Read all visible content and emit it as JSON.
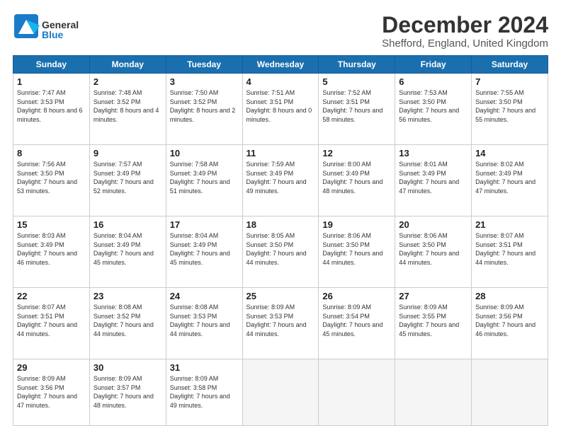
{
  "logo": {
    "general": "General",
    "blue": "Blue"
  },
  "title": "December 2024",
  "location": "Shefford, England, United Kingdom",
  "headers": [
    "Sunday",
    "Monday",
    "Tuesday",
    "Wednesday",
    "Thursday",
    "Friday",
    "Saturday"
  ],
  "weeks": [
    [
      {
        "day": "1",
        "sunrise": "Sunrise: 7:47 AM",
        "sunset": "Sunset: 3:53 PM",
        "daylight": "Daylight: 8 hours and 6 minutes."
      },
      {
        "day": "2",
        "sunrise": "Sunrise: 7:48 AM",
        "sunset": "Sunset: 3:52 PM",
        "daylight": "Daylight: 8 hours and 4 minutes."
      },
      {
        "day": "3",
        "sunrise": "Sunrise: 7:50 AM",
        "sunset": "Sunset: 3:52 PM",
        "daylight": "Daylight: 8 hours and 2 minutes."
      },
      {
        "day": "4",
        "sunrise": "Sunrise: 7:51 AM",
        "sunset": "Sunset: 3:51 PM",
        "daylight": "Daylight: 8 hours and 0 minutes."
      },
      {
        "day": "5",
        "sunrise": "Sunrise: 7:52 AM",
        "sunset": "Sunset: 3:51 PM",
        "daylight": "Daylight: 7 hours and 58 minutes."
      },
      {
        "day": "6",
        "sunrise": "Sunrise: 7:53 AM",
        "sunset": "Sunset: 3:50 PM",
        "daylight": "Daylight: 7 hours and 56 minutes."
      },
      {
        "day": "7",
        "sunrise": "Sunrise: 7:55 AM",
        "sunset": "Sunset: 3:50 PM",
        "daylight": "Daylight: 7 hours and 55 minutes."
      }
    ],
    [
      {
        "day": "8",
        "sunrise": "Sunrise: 7:56 AM",
        "sunset": "Sunset: 3:50 PM",
        "daylight": "Daylight: 7 hours and 53 minutes."
      },
      {
        "day": "9",
        "sunrise": "Sunrise: 7:57 AM",
        "sunset": "Sunset: 3:49 PM",
        "daylight": "Daylight: 7 hours and 52 minutes."
      },
      {
        "day": "10",
        "sunrise": "Sunrise: 7:58 AM",
        "sunset": "Sunset: 3:49 PM",
        "daylight": "Daylight: 7 hours and 51 minutes."
      },
      {
        "day": "11",
        "sunrise": "Sunrise: 7:59 AM",
        "sunset": "Sunset: 3:49 PM",
        "daylight": "Daylight: 7 hours and 49 minutes."
      },
      {
        "day": "12",
        "sunrise": "Sunrise: 8:00 AM",
        "sunset": "Sunset: 3:49 PM",
        "daylight": "Daylight: 7 hours and 48 minutes."
      },
      {
        "day": "13",
        "sunrise": "Sunrise: 8:01 AM",
        "sunset": "Sunset: 3:49 PM",
        "daylight": "Daylight: 7 hours and 47 minutes."
      },
      {
        "day": "14",
        "sunrise": "Sunrise: 8:02 AM",
        "sunset": "Sunset: 3:49 PM",
        "daylight": "Daylight: 7 hours and 47 minutes."
      }
    ],
    [
      {
        "day": "15",
        "sunrise": "Sunrise: 8:03 AM",
        "sunset": "Sunset: 3:49 PM",
        "daylight": "Daylight: 7 hours and 46 minutes."
      },
      {
        "day": "16",
        "sunrise": "Sunrise: 8:04 AM",
        "sunset": "Sunset: 3:49 PM",
        "daylight": "Daylight: 7 hours and 45 minutes."
      },
      {
        "day": "17",
        "sunrise": "Sunrise: 8:04 AM",
        "sunset": "Sunset: 3:49 PM",
        "daylight": "Daylight: 7 hours and 45 minutes."
      },
      {
        "day": "18",
        "sunrise": "Sunrise: 8:05 AM",
        "sunset": "Sunset: 3:50 PM",
        "daylight": "Daylight: 7 hours and 44 minutes."
      },
      {
        "day": "19",
        "sunrise": "Sunrise: 8:06 AM",
        "sunset": "Sunset: 3:50 PM",
        "daylight": "Daylight: 7 hours and 44 minutes."
      },
      {
        "day": "20",
        "sunrise": "Sunrise: 8:06 AM",
        "sunset": "Sunset: 3:50 PM",
        "daylight": "Daylight: 7 hours and 44 minutes."
      },
      {
        "day": "21",
        "sunrise": "Sunrise: 8:07 AM",
        "sunset": "Sunset: 3:51 PM",
        "daylight": "Daylight: 7 hours and 44 minutes."
      }
    ],
    [
      {
        "day": "22",
        "sunrise": "Sunrise: 8:07 AM",
        "sunset": "Sunset: 3:51 PM",
        "daylight": "Daylight: 7 hours and 44 minutes."
      },
      {
        "day": "23",
        "sunrise": "Sunrise: 8:08 AM",
        "sunset": "Sunset: 3:52 PM",
        "daylight": "Daylight: 7 hours and 44 minutes."
      },
      {
        "day": "24",
        "sunrise": "Sunrise: 8:08 AM",
        "sunset": "Sunset: 3:53 PM",
        "daylight": "Daylight: 7 hours and 44 minutes."
      },
      {
        "day": "25",
        "sunrise": "Sunrise: 8:09 AM",
        "sunset": "Sunset: 3:53 PM",
        "daylight": "Daylight: 7 hours and 44 minutes."
      },
      {
        "day": "26",
        "sunrise": "Sunrise: 8:09 AM",
        "sunset": "Sunset: 3:54 PM",
        "daylight": "Daylight: 7 hours and 45 minutes."
      },
      {
        "day": "27",
        "sunrise": "Sunrise: 8:09 AM",
        "sunset": "Sunset: 3:55 PM",
        "daylight": "Daylight: 7 hours and 45 minutes."
      },
      {
        "day": "28",
        "sunrise": "Sunrise: 8:09 AM",
        "sunset": "Sunset: 3:56 PM",
        "daylight": "Daylight: 7 hours and 46 minutes."
      }
    ],
    [
      {
        "day": "29",
        "sunrise": "Sunrise: 8:09 AM",
        "sunset": "Sunset: 3:56 PM",
        "daylight": "Daylight: 7 hours and 47 minutes."
      },
      {
        "day": "30",
        "sunrise": "Sunrise: 8:09 AM",
        "sunset": "Sunset: 3:57 PM",
        "daylight": "Daylight: 7 hours and 48 minutes."
      },
      {
        "day": "31",
        "sunrise": "Sunrise: 8:09 AM",
        "sunset": "Sunset: 3:58 PM",
        "daylight": "Daylight: 7 hours and 49 minutes."
      },
      null,
      null,
      null,
      null
    ]
  ]
}
